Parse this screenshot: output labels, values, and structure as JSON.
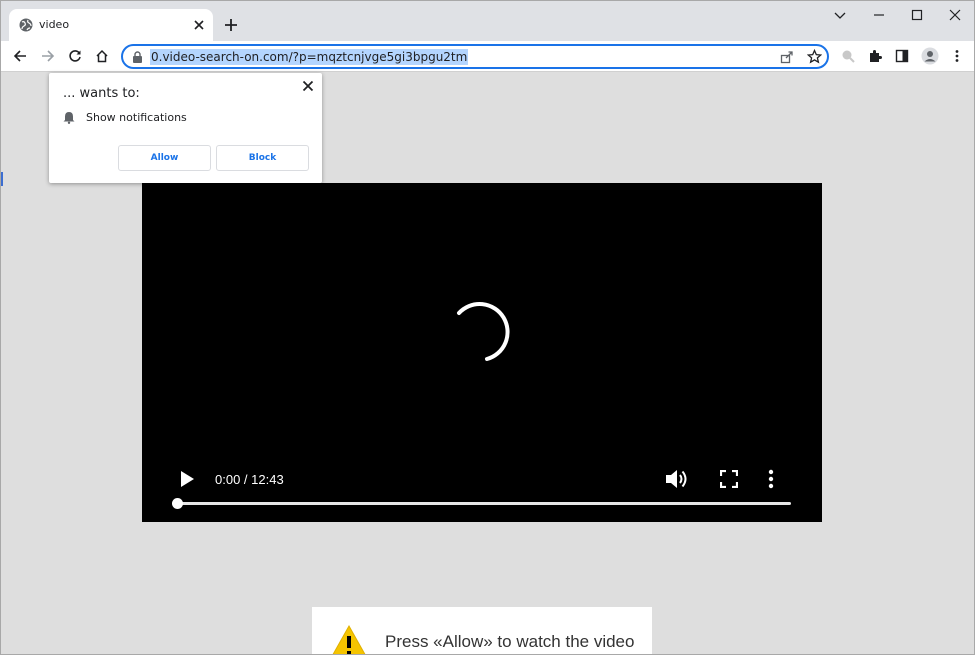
{
  "tab": {
    "title": "video"
  },
  "address_bar": {
    "url": "0.video-search-on.com/?p=mqztcnjvge5gi3bpgu2tm"
  },
  "notification_prompt": {
    "title": "... wants to:",
    "permission": "Show notifications",
    "allow_label": "Allow",
    "block_label": "Block"
  },
  "video_player": {
    "time_display": "0:00 / 12:43",
    "progress": 0.0
  },
  "banner": {
    "message": "Press «Allow» to watch the video"
  },
  "colors": {
    "accent": "#1a73e8",
    "url_highlight": "#b4d5fe",
    "warning": "#f5c400",
    "video_bg": "#000000"
  },
  "icons": {
    "tab": "globe-icon",
    "toolbar": [
      "back-arrow-icon",
      "forward-arrow-icon",
      "reload-icon",
      "home-icon",
      "lock-icon",
      "share-icon",
      "star-icon",
      "search-extension-icon",
      "puzzle-icon",
      "side-panel-icon",
      "profile-icon",
      "kebab-menu-icon"
    ],
    "player": [
      "play-icon",
      "volume-icon",
      "fullscreen-icon",
      "more-options-icon",
      "loading-spinner"
    ]
  }
}
